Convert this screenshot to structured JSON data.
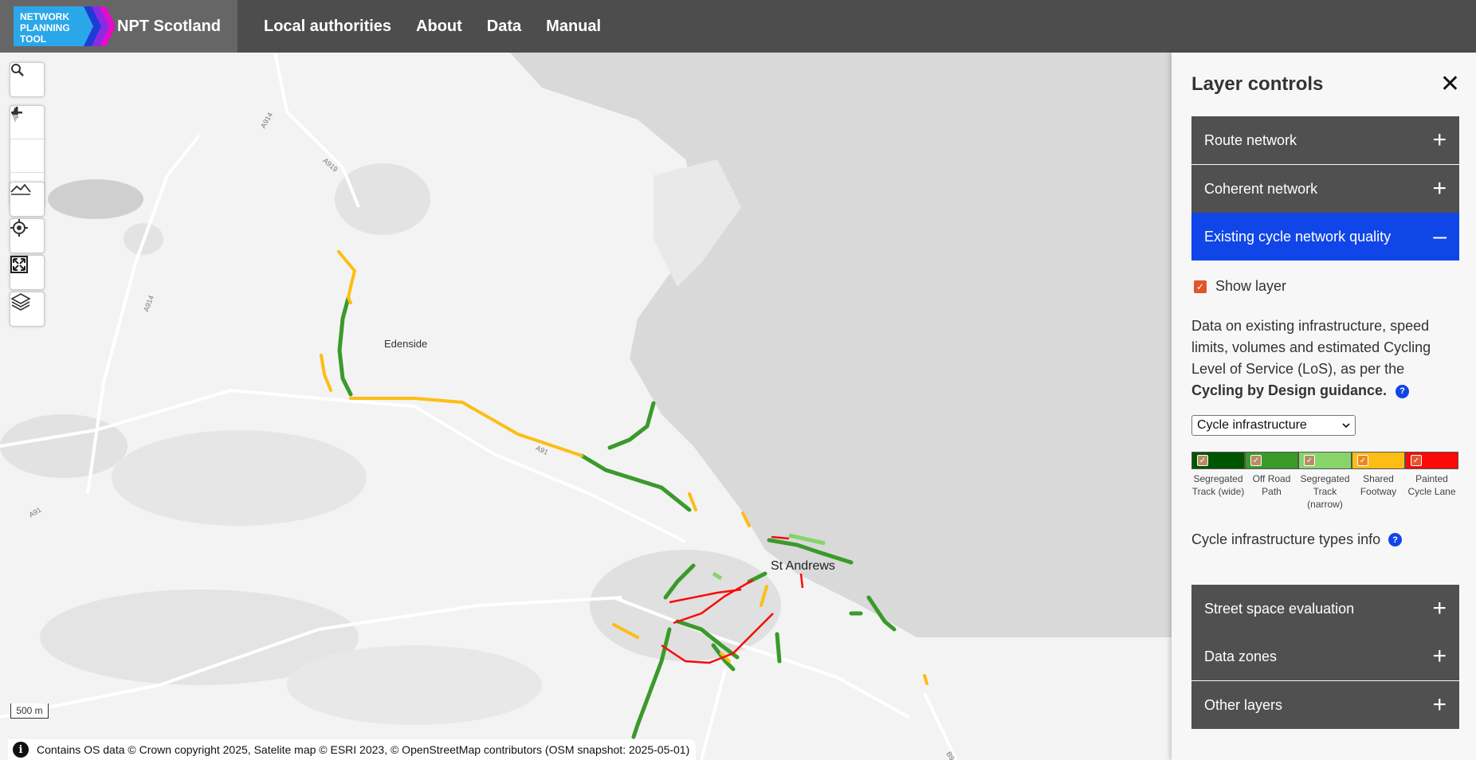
{
  "header": {
    "logo_lines": [
      "NETWORK",
      "PLANNING",
      "TOOL"
    ],
    "title": "NPT Scotland",
    "nav": [
      "Local authorities",
      "About",
      "Data",
      "Manual"
    ]
  },
  "map": {
    "place_labels": [
      "Edenside",
      "St Andrews"
    ],
    "road_labels": [
      "A914",
      "A919",
      "A914",
      "A91",
      "A91",
      "B9"
    ],
    "scale": "500 m",
    "attribution": "Contains OS data © Crown copyright 2025, Satelite map © ESRI 2023, © OpenStreetMap contributors (OSM snapshot: 2025-05-01)",
    "controls": [
      "search-icon",
      "zoom-in-icon",
      "zoom-out-icon",
      "compass-icon",
      "terrain-icon",
      "geolocate-icon",
      "fullscreen-icon",
      "layers-icon"
    ]
  },
  "panel": {
    "title": "Layer controls",
    "close": "✕",
    "sections_top": [
      {
        "label": "Route network",
        "sign": "+"
      },
      {
        "label": "Coherent network",
        "sign": "+"
      },
      {
        "label": "Existing cycle network quality",
        "sign": "–"
      }
    ],
    "show_layer": "Show layer",
    "description_plain": "Data on existing infrastructure, speed limits, volumes and estimated Cycling Level of Service (LoS), as per the",
    "description_bold": "Cycling by Design guidance.",
    "select_value": "Cycle infrastructure",
    "legend": [
      {
        "label": "Segregated Track (wide)",
        "color": "#005500"
      },
      {
        "label": "Off Road Path",
        "color": "#3a9a2a"
      },
      {
        "label": "Segregated Track (narrow)",
        "color": "#86d46a"
      },
      {
        "label": "Shared Footway",
        "color": "#fdbd14"
      },
      {
        "label": "Painted Cycle Lane",
        "color": "#fb0a0a"
      }
    ],
    "info_text": "Cycle infrastructure types info",
    "sections_bottom": [
      {
        "label": "Street space evaluation",
        "sign": "+"
      },
      {
        "label": "Data zones",
        "sign": "+"
      },
      {
        "label": "Other layers",
        "sign": "+"
      }
    ]
  }
}
